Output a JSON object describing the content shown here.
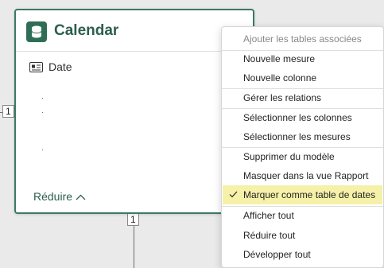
{
  "table_card": {
    "title": "Calendar",
    "field": "Date",
    "collapse_label": "Réduire",
    "accent_color": "#3b7a63"
  },
  "relationships": {
    "left_cardinality": "1",
    "bottom_cardinality": "1"
  },
  "context_menu": {
    "items": [
      {
        "label": "Ajouter les tables associées",
        "disabled": true
      },
      {
        "label": "Nouvelle mesure"
      },
      {
        "label": "Nouvelle colonne"
      },
      {
        "label": "Gérer les relations"
      },
      {
        "label": "Sélectionner les colonnes"
      },
      {
        "label": "Sélectionner les mesures"
      },
      {
        "label": "Supprimer du modèle"
      },
      {
        "label": "Masquer dans la vue Rapport"
      },
      {
        "label": "Marquer comme table de dates",
        "checked": true,
        "check_icon": "checkmark-icon"
      },
      {
        "label": "Afficher tout"
      },
      {
        "label": "Réduire tout"
      },
      {
        "label": "Développer tout"
      }
    ],
    "highlight_color": "#f5f1a8"
  }
}
